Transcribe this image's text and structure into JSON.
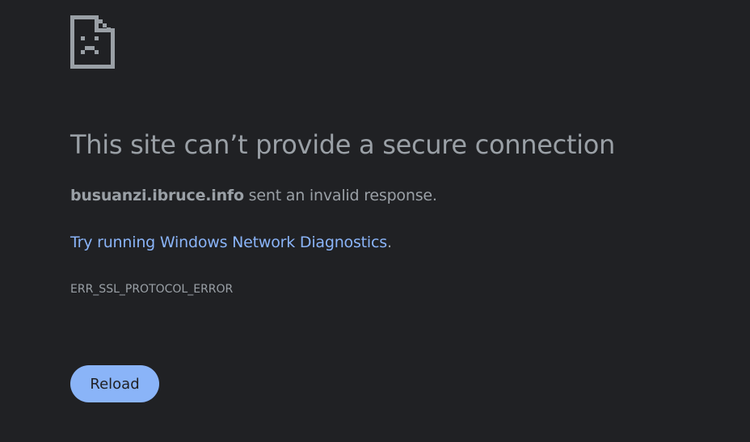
{
  "icon": "sad-page-icon",
  "title": "This site can’t provide a secure connection",
  "summary": {
    "host": "busuanzi.ibruce.info",
    "text": " sent an invalid response."
  },
  "suggestion": {
    "prefix": "Try running ",
    "link_text": "Windows Network Diagnostics",
    "suffix": "."
  },
  "error_code": "ERR_SSL_PROTOCOL_ERROR",
  "reload_label": "Reload",
  "colors": {
    "background": "#202124",
    "text": "#9aa0a6",
    "link": "#8ab4f8",
    "button_bg": "#8ab4f8",
    "button_text": "#202124"
  }
}
